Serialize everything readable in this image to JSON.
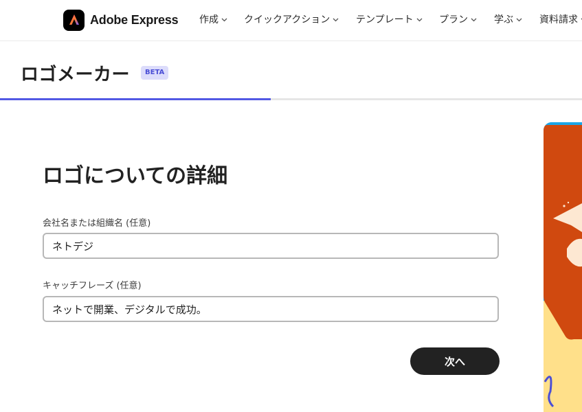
{
  "header": {
    "brand_name": "Adobe Express",
    "nav": [
      {
        "label": "作成"
      },
      {
        "label": "クイックアクション"
      },
      {
        "label": "テンプレート"
      },
      {
        "label": "プラン"
      },
      {
        "label": "学ぶ"
      },
      {
        "label": "資料請求"
      }
    ]
  },
  "page": {
    "title": "ロゴメーカー",
    "badge": "BETA",
    "progress_fraction": 0.465
  },
  "form": {
    "heading": "ロゴについての詳細",
    "company": {
      "label": "会社名または組織名 (任意)",
      "value": "ネトデジ"
    },
    "tagline": {
      "label": "キャッチフレーズ (任意)",
      "value": "ネットで開業、デジタルで成功。"
    },
    "next_label": "次へ"
  },
  "colors": {
    "accent": "#5258e4",
    "badge_bg": "#dcdcfb",
    "button_bg": "#222222",
    "hero_orange": "#d0490f",
    "hero_yellow": "#ffe08a",
    "hero_blue": "#1aa6e8"
  }
}
